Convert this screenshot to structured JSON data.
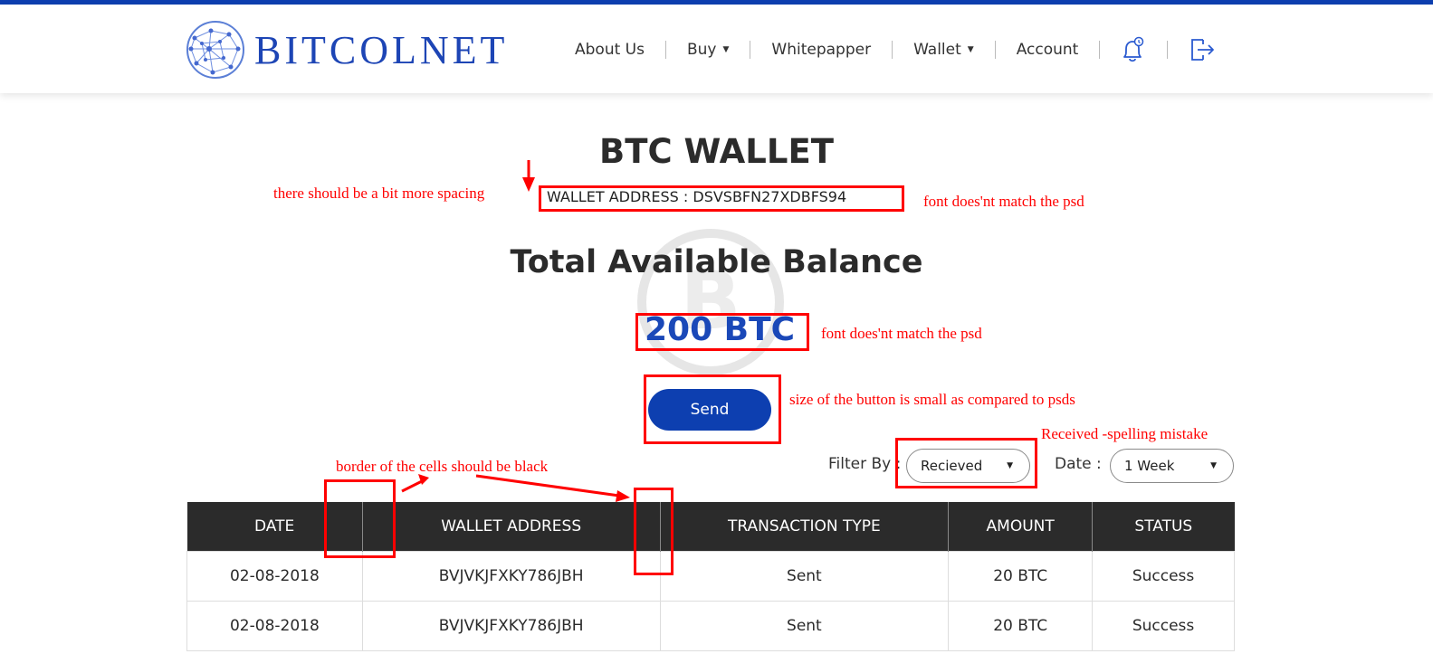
{
  "brand": {
    "name": "BITCOLNET",
    "accent": "#0d3fb0"
  },
  "nav": {
    "items": [
      {
        "label": "About Us"
      },
      {
        "label": "Buy"
      },
      {
        "label": "Whitepapper"
      },
      {
        "label": "Wallet"
      },
      {
        "label": "Account"
      }
    ],
    "icons": [
      "bell-icon",
      "logout-icon"
    ]
  },
  "wallet": {
    "title": "BTC WALLET",
    "address": "WALLET ADDRESS : DSVSBFN27XDBFS94",
    "balance_title": "Total Available Balance",
    "balance": "200 BTC",
    "send_label": "Send"
  },
  "filters": {
    "filter_label": "Filter By :",
    "filter_value": "Recieved",
    "date_label": "Date :",
    "date_value": "1 Week"
  },
  "table": {
    "headers": [
      "DATE",
      "WALLET ADDRESS",
      "TRANSACTION TYPE",
      "AMOUNT",
      "STATUS"
    ],
    "rows": [
      {
        "date": "02-08-2018",
        "address": "BVJVKJFXKY786JBH",
        "type": "Sent",
        "amount": "20 BTC",
        "status": "Success"
      },
      {
        "date": "02-08-2018",
        "address": "BVJVKJFXKY786JBH",
        "type": "Sent",
        "amount": "20 BTC",
        "status": "Success"
      }
    ],
    "status_color": "#4caf50"
  },
  "annotations": {
    "spacing": "there should be a bit more spacing",
    "font_address": "font does'nt match the psd",
    "font_balance": "font does'nt match the psd",
    "button_size": "size of the button is small as compared to psds",
    "spelling": "Received -spelling mistake",
    "border": "border of the cells should be black",
    "color": "#ff0000"
  }
}
